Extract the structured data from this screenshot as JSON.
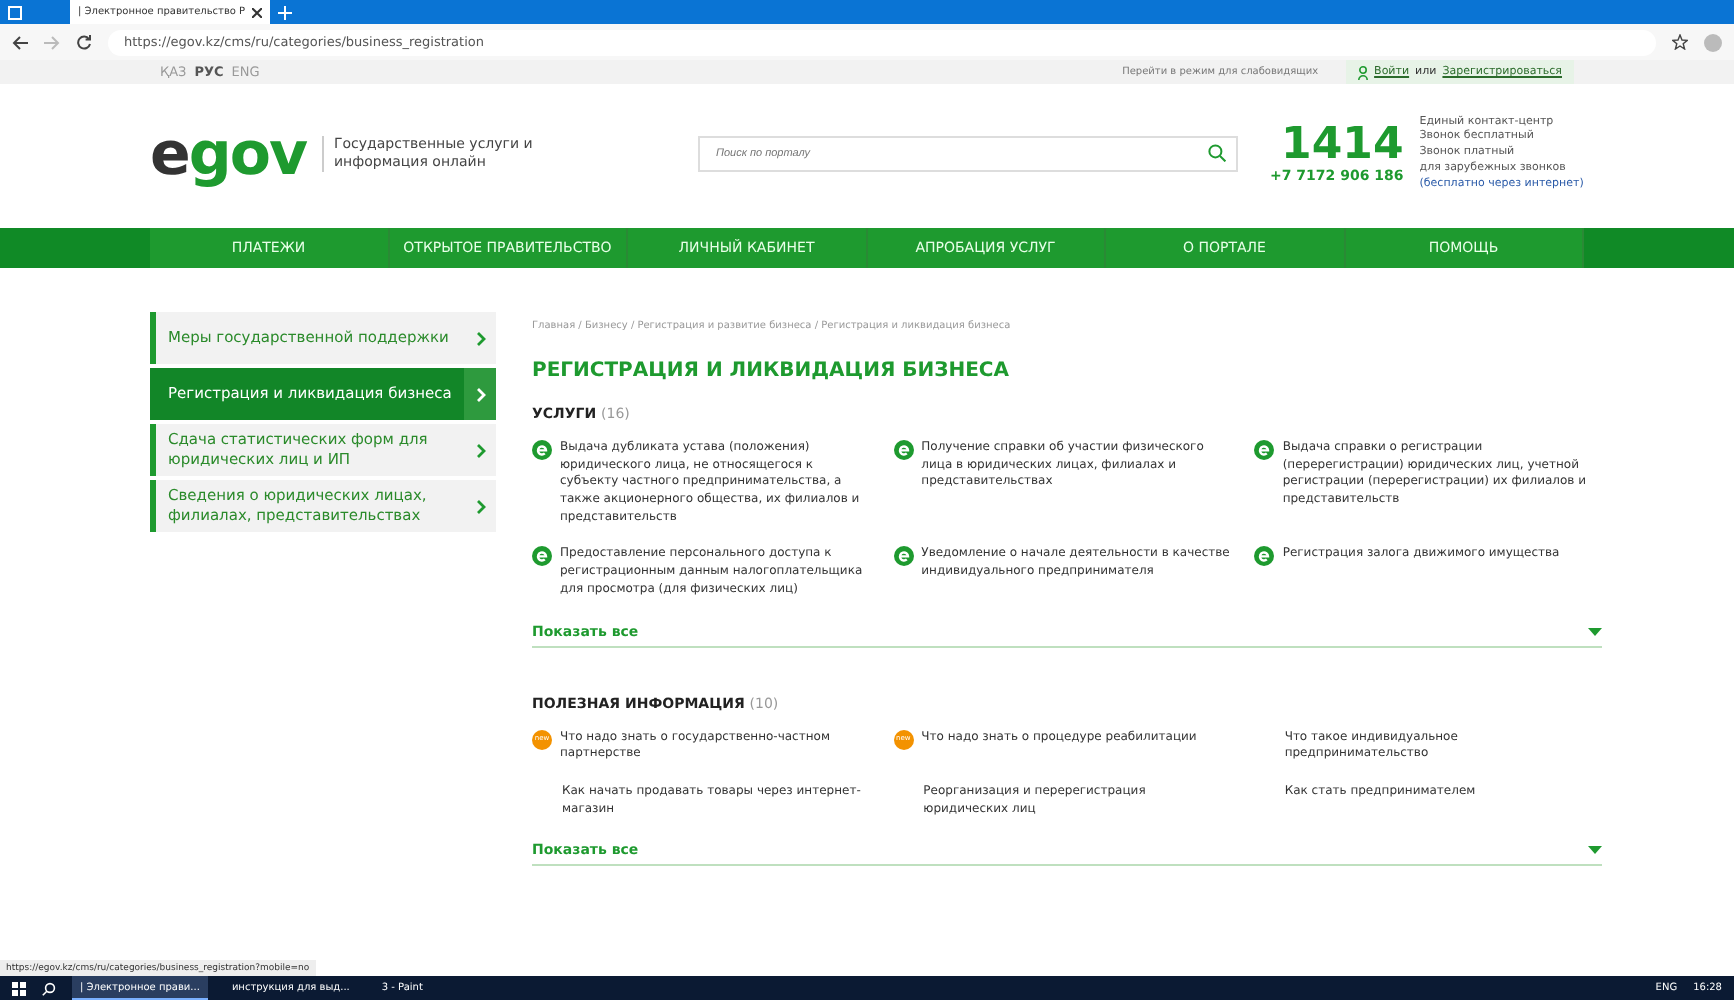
{
  "browser": {
    "tab_title": "| Электронное правительство Р",
    "url": "https://egov.kz/cms/ru/categories/business_registration",
    "status_url": "https://egov.kz/cms/ru/categories/business_registration?mobile=no"
  },
  "top_bar": {
    "languages": [
      {
        "label": "ҚАЗ",
        "selected": false
      },
      {
        "label": "РУС",
        "selected": true
      },
      {
        "label": "ENG",
        "selected": false
      }
    ],
    "low_vision_link": "Перейти в режим для слабовидящих",
    "login_link": "Войти",
    "login_joiner": "или",
    "register_link": "Зарегистрироваться"
  },
  "header": {
    "logo_left": "e",
    "logo_right": "gov",
    "tagline": "Государственные услуги и информация онлайн",
    "search": {
      "placeholder": "Поиск по порталу"
    },
    "hotline": "1414",
    "phone": "+7 7172 906 186",
    "contact_lines": [
      "Единый контакт-центр",
      "Звонок бесплатный",
      "Звонок платный",
      "для зарубежных звонков"
    ],
    "contact_note": "(бесплатно через интернет)"
  },
  "nav": [
    "ПЛАТЕЖИ",
    "ОТКРЫТОЕ ПРАВИТЕЛЬСТВО",
    "ЛИЧНЫЙ КАБИНЕТ",
    "АПРОБАЦИЯ УСЛУГ",
    "О ПОРТАЛЕ",
    "ПОМОЩЬ"
  ],
  "sidebar": [
    {
      "label": "Меры государственной поддержки",
      "selected": false
    },
    {
      "label": "Регистрация и ликвидация бизнеса",
      "selected": true
    },
    {
      "label": "Сдача статистических форм для юридических лиц и ИП",
      "selected": false
    },
    {
      "label": "Сведения о юридических лицах, филиалах, представительствах",
      "selected": false
    }
  ],
  "breadcrumbs": "Главная / Бизнесу / Регистрация и развитие бизнеса / Регистрация и ликвидация бизнеса",
  "title": "РЕГИСТРАЦИЯ И ЛИКВИДАЦИЯ БИЗНЕСА",
  "sections": [
    {
      "title": "УСЛУГИ",
      "count": "(16)",
      "show_all": "Показать все",
      "items": [
        {
          "kind": "egov",
          "text": "Выдача дубликата устава (положения) юридического лица, не относящегося к субъекту частного предпринимательства, а также акционерного общества, их филиалов и представительств"
        },
        {
          "kind": "egov",
          "text": "Получение справки об участии физического лица в юридических лицах, филиалах и представительствах"
        },
        {
          "kind": "egov",
          "text": "Выдача справки о регистрации (перерегистрации) юридических лиц, учетной регистрации (перерегистрации) их филиалов и представительств"
        },
        {
          "kind": "egov",
          "text": "Предоставление персонального доступа к регистрационным данным налогоплательщика для просмотра (для физических лиц)"
        },
        {
          "kind": "egov",
          "text": "Уведомление о начале деятельности в качестве индивидуального предпринимателя"
        },
        {
          "kind": "egov",
          "text": "Регистрация залога движимого имущества"
        }
      ]
    },
    {
      "title": "ПОЛЕЗНАЯ ИНФОРМАЦИЯ",
      "count": "(10)",
      "show_all": "Показать все",
      "items": [
        {
          "kind": "new",
          "badge": "new",
          "text": "Что надо знать о государственно-частном партнерстве"
        },
        {
          "kind": "new",
          "badge": "new",
          "text": "Что надо знать о процедуре реабилитации"
        },
        {
          "kind": "plain",
          "text": "Что такое индивидуальное предпринимательство"
        },
        {
          "kind": "plain",
          "text": "Как начать продавать товары через интернет-магазин"
        },
        {
          "kind": "plain",
          "text": "Реорганизация и перерегистрация юридических лиц"
        },
        {
          "kind": "plain",
          "text": "Как стать предпринимателем"
        }
      ]
    }
  ],
  "taskbar": {
    "apps": [
      {
        "label": "| Электронное прави...",
        "selected": true
      },
      {
        "label": "инструкция для выд...",
        "selected": false
      },
      {
        "label": "3 - Paint",
        "selected": false
      }
    ],
    "language": "ENG",
    "time": "16:28"
  }
}
